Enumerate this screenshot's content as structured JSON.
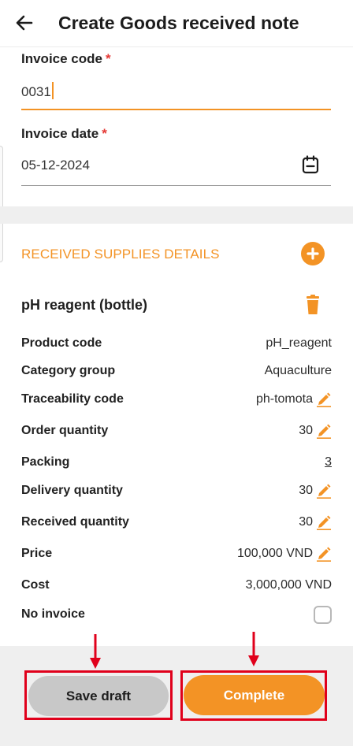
{
  "header": {
    "title": "Create Goods received note",
    "back_icon": "arrow-left-icon"
  },
  "form": {
    "invoice_code": {
      "label": "Invoice code",
      "required_mark": "*",
      "value": "0031"
    },
    "invoice_date": {
      "label": "Invoice date",
      "required_mark": "*",
      "value": "05-12-2024",
      "icon": "calendar-icon"
    }
  },
  "supplies": {
    "section_title": "RECEIVED SUPPLIES DETAILS",
    "item": {
      "name": "pH reagent (bottle)",
      "rows": [
        {
          "label": "Product code",
          "value": "pH_reagent",
          "editable": false
        },
        {
          "label": "Category group",
          "value": "Aquaculture",
          "editable": false
        },
        {
          "label": "Traceability code",
          "value": "ph-tomota",
          "editable": true
        },
        {
          "label": "Order quantity",
          "value": "30",
          "editable": true
        },
        {
          "label": "Packing",
          "value": "3",
          "editable": false,
          "underline": true
        },
        {
          "label": "Delivery quantity",
          "value": "30",
          "editable": true
        },
        {
          "label": "Received quantity",
          "value": "30",
          "editable": true
        },
        {
          "label": "Price",
          "value": "100,000 VND",
          "editable": true
        },
        {
          "label": "Cost",
          "value": "3,000,000 VND",
          "editable": false
        }
      ],
      "no_invoice": {
        "label": "No invoice",
        "checked": false
      }
    }
  },
  "footer": {
    "save_draft_label": "Save draft",
    "complete_label": "Complete"
  },
  "colors": {
    "accent": "#f39325",
    "required": "#e53935",
    "annotation": "#e0001b",
    "draft_button": "#c8c8c8"
  }
}
